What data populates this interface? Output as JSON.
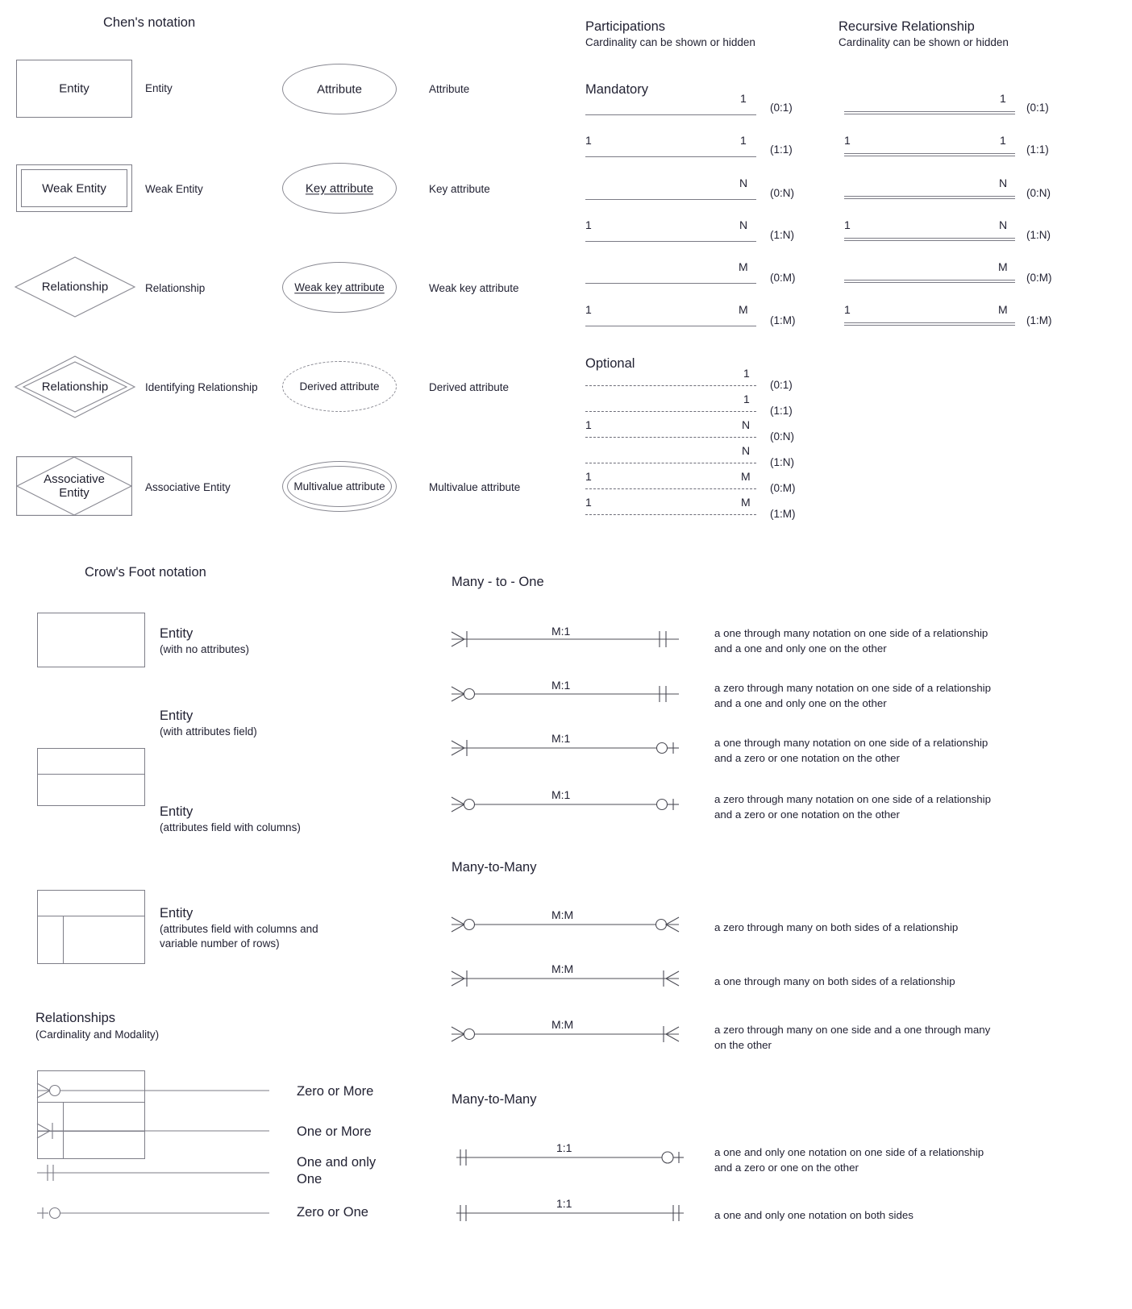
{
  "chen": {
    "title": "Chen's notation",
    "shapes": [
      {
        "id": "entity",
        "inner": "Entity",
        "label": "Entity"
      },
      {
        "id": "weak-entity",
        "inner": "Weak Entity",
        "label": "Weak Entity"
      },
      {
        "id": "relationship",
        "inner": "Relationship",
        "label": "Relationship"
      },
      {
        "id": "identifying-relationship",
        "inner": "Relationship",
        "label": "Identifying Relationship"
      },
      {
        "id": "associative-entity",
        "inner": "Associative\nEntity",
        "label": "Associative Entity"
      }
    ],
    "attributes": [
      {
        "id": "attribute",
        "inner": "Attribute",
        "label": "Attribute"
      },
      {
        "id": "key-attribute",
        "inner": "Key attribute",
        "label": "Key attribute"
      },
      {
        "id": "weak-key-attribute",
        "inner": "Weak key attribute",
        "label": "Weak key attribute"
      },
      {
        "id": "derived-attribute",
        "inner": "Derived attribute",
        "label": "Derived attribute"
      },
      {
        "id": "multivalue-attribute",
        "inner": "Multivalue attribute",
        "label": "Multivalue attribute"
      }
    ]
  },
  "participations": {
    "title": "Participations",
    "subtitle": "Cardinality can be shown or hidden",
    "mandatory_label": "Mandatory",
    "optional_label": "Optional",
    "mandatory": [
      {
        "left": "",
        "right": "1",
        "card": "(0:1)"
      },
      {
        "left": "1",
        "right": "1",
        "card": "(1:1)"
      },
      {
        "left": "",
        "right": "N",
        "card": "(0:N)"
      },
      {
        "left": "1",
        "right": "N",
        "card": "(1:N)"
      },
      {
        "left": "",
        "right": "M",
        "card": "(0:M)"
      },
      {
        "left": "1",
        "right": "M",
        "card": "(1:M)"
      }
    ],
    "optional": [
      {
        "left": "",
        "right": "1",
        "card": "(0:1)"
      },
      {
        "left": "",
        "right": "1",
        "card": "(1:1)"
      },
      {
        "left": "1",
        "right": "N",
        "card": "(0:N)"
      },
      {
        "left": "",
        "right": "N",
        "card": "(1:N)"
      },
      {
        "left": "1",
        "right": "M",
        "card": "(0:M)"
      },
      {
        "left": "1",
        "right": "M",
        "card": "(1:M)"
      }
    ]
  },
  "recursive": {
    "title": "Recursive Relationship",
    "subtitle": "Cardinality can be shown or hidden",
    "rows": [
      {
        "left": "",
        "right": "1",
        "card": "(0:1)"
      },
      {
        "left": "1",
        "right": "1",
        "card": "(1:1)"
      },
      {
        "left": "",
        "right": "N",
        "card": "(0:N)"
      },
      {
        "left": "1",
        "right": "N",
        "card": "(1:N)"
      },
      {
        "left": "",
        "right": "M",
        "card": "(0:M)"
      },
      {
        "left": "1",
        "right": "M",
        "card": "(1:M)"
      }
    ]
  },
  "crowsfoot": {
    "title": "Crow's Foot notation",
    "entities": [
      {
        "id": "entity-no-attributes",
        "label": "Entity",
        "sub": "(with no attributes)"
      },
      {
        "id": "entity-attributes-field",
        "label": "Entity",
        "sub": "(with attributes field)"
      },
      {
        "id": "entity-attributes-columns",
        "label": "Entity",
        "sub": "(attributes field with columns)"
      },
      {
        "id": "entity-attributes-columns-rows",
        "label": "Entity",
        "sub": "(attributes field with columns and\nvariable number of rows)"
      }
    ],
    "relationships_title": "Relationships",
    "relationships_subtitle": "(Cardinality and Modality)",
    "modality": [
      {
        "id": "zero-or-more",
        "end": "crowfoot-circle",
        "label": "Zero or More"
      },
      {
        "id": "one-or-more",
        "end": "crowfoot-bar",
        "label": "One or More"
      },
      {
        "id": "one-and-only-one",
        "end": "double-bar",
        "label": "One and only\nOne"
      },
      {
        "id": "zero-or-one",
        "end": "bar-circle",
        "label": "Zero or One"
      }
    ]
  },
  "many_to_one": {
    "title": "Many - to - One",
    "rows": [
      {
        "cardinality": "M:1",
        "left_end": "crowfoot-bar",
        "right_end": "double-bar",
        "desc": "a one through many notation on one side of a relationship\nand a one and only one on the other"
      },
      {
        "cardinality": "M:1",
        "left_end": "crowfoot-circle",
        "right_end": "double-bar",
        "desc": "a zero through many notation on one side of a relationship\nand a one and only one on the other"
      },
      {
        "cardinality": "M:1",
        "left_end": "crowfoot-bar",
        "right_end": "circle-bar",
        "desc": "a one through many notation on one side of a relationship\nand a zero or one notation on the other"
      },
      {
        "cardinality": "M:1",
        "left_end": "crowfoot-circle",
        "right_end": "circle-bar",
        "desc": "a zero through many notation on one side of a relationship\nand a zero or one notation on the other"
      }
    ]
  },
  "many_to_many": {
    "title": "Many-to-Many",
    "rows": [
      {
        "cardinality": "M:M",
        "left_end": "crowfoot-circle",
        "right_end": "circle-crowfoot",
        "desc": "a zero through many on both sides of a relationship"
      },
      {
        "cardinality": "M:M",
        "left_end": "crowfoot-bar",
        "right_end": "bar-crowfoot",
        "desc": "a one through many on both sides of a relationship"
      },
      {
        "cardinality": "M:M",
        "left_end": "crowfoot-circle",
        "right_end": "bar-crowfoot",
        "desc": "a zero through many on one side and a one through many\non the other"
      }
    ]
  },
  "one_to_one": {
    "title": "Many-to-Many",
    "rows": [
      {
        "cardinality": "1:1",
        "left_end": "double-bar",
        "right_end": "circle-bar",
        "desc": "a one and only one notation on one side of a relationship\nand a zero or one on the other"
      },
      {
        "cardinality": "1:1",
        "left_end": "double-bar",
        "right_end": "double-bar",
        "desc": "a one and only one notation on both sides"
      }
    ]
  },
  "colors": {
    "stroke": "#7b7b85",
    "shape_stroke": "#7e7e88",
    "text": "#222233",
    "background": "#ffffff"
  }
}
